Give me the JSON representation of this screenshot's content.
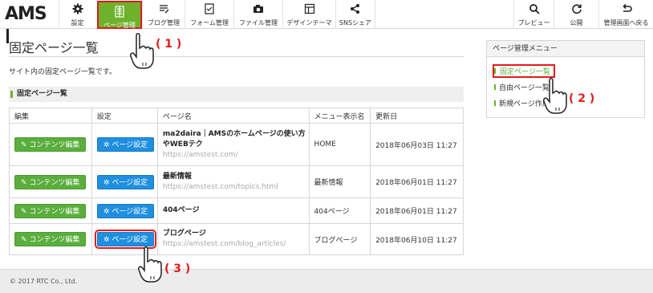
{
  "app": {
    "logo": "AMS"
  },
  "toolbar": {
    "left": [
      {
        "label": "設定",
        "icon": "gear-icon"
      },
      {
        "label": "ページ管理",
        "icon": "page-icon",
        "active": true
      },
      {
        "label": "ブログ管理",
        "icon": "blog-icon"
      },
      {
        "label": "フォーム管理",
        "icon": "form-icon"
      },
      {
        "label": "ファイル管理",
        "icon": "camera-icon"
      },
      {
        "label": "デザインテーマ",
        "icon": "theme-icon"
      },
      {
        "label": "SNSシェア",
        "icon": "share-icon"
      }
    ],
    "right": [
      {
        "label": "プレビュー",
        "icon": "search-icon"
      },
      {
        "label": "公開",
        "icon": "refresh-icon"
      },
      {
        "label": "管理画面へ戻る",
        "icon": "return-icon"
      }
    ]
  },
  "main": {
    "title": "固定ページ一覧",
    "description": "サイト内の固定ページ一覧です。",
    "section_title": "固定ページ一覧"
  },
  "table": {
    "headers": [
      "編集",
      "設定",
      "ページ名",
      "メニュー表示名",
      "更新日"
    ],
    "edit_label": "コンテンツ編集",
    "settings_label": "ページ設定",
    "rows": [
      {
        "name": "ma2daira｜AMSのホームページの使い方やWEBテク",
        "url": "https://amstest.com/",
        "menu": "HOME",
        "date": "2018年06月03日 11:27"
      },
      {
        "name": "最新情報",
        "url": "https://amstest.com/topics.html",
        "menu": "最新情報",
        "date": "2018年06月01日 11:27"
      },
      {
        "name": "404ページ",
        "url": "",
        "menu": "404ページ",
        "date": "2018年06月01日 11:27"
      },
      {
        "name": "ブログページ",
        "url": "https://amstest.com/blog_articles/",
        "menu": "ブログページ",
        "date": "2018年06月10日 11:27"
      }
    ]
  },
  "sidebar": {
    "title": "ページ管理メニュー",
    "items": [
      {
        "label": "固定ページ一覧",
        "active": true
      },
      {
        "label": "自由ページ一覧"
      },
      {
        "label": "新規ページ作成"
      }
    ]
  },
  "footer": {
    "copyright": "© 2017 RTC Co., Ltd."
  },
  "annotations": {
    "step1": "( 1 )",
    "step2": "( 2 )",
    "step3": "( 3 )"
  },
  "colors": {
    "accent_green": "#6eb12c",
    "button_blue": "#1f8fe0",
    "highlight_red": "#e21b1b"
  }
}
